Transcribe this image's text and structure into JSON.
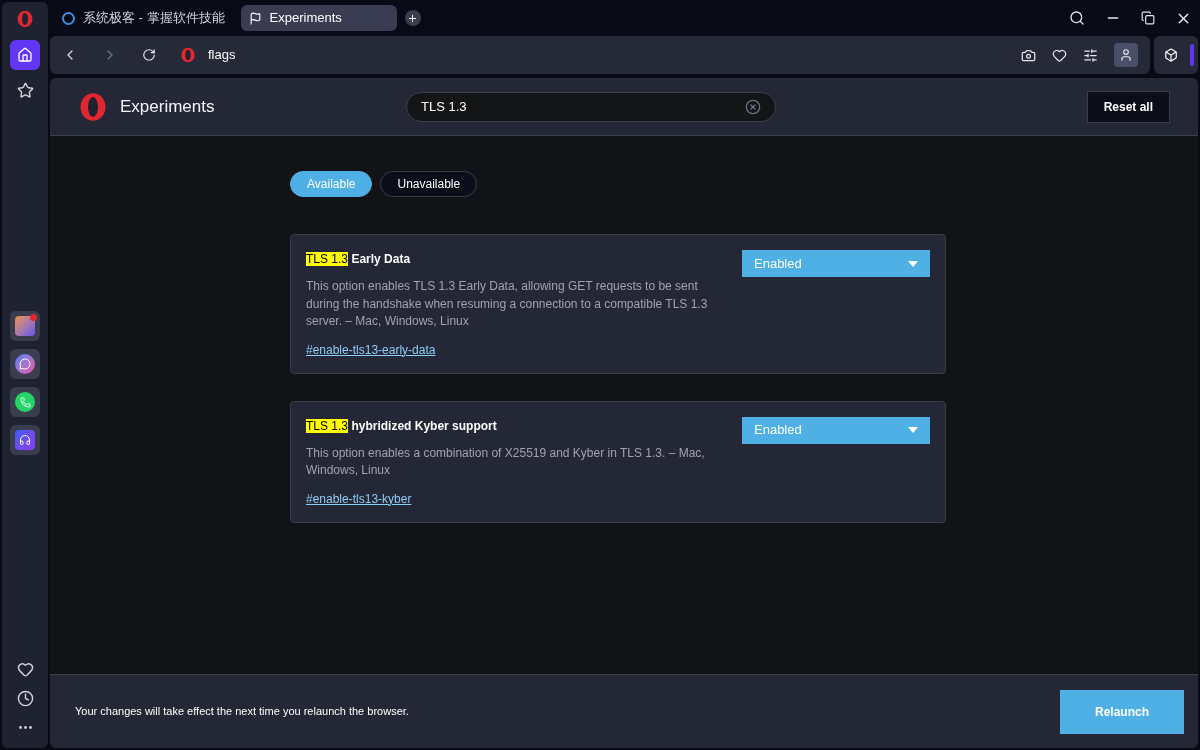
{
  "tabs": [
    {
      "title": "系统极客 - 掌握软件技能",
      "selected": false
    },
    {
      "title": "Experiments",
      "selected": true
    }
  ],
  "address_bar": {
    "url": "flags"
  },
  "header": {
    "title": "Experiments",
    "search": {
      "value": "TLS 1.3"
    },
    "reset_button": "Reset all"
  },
  "filter_tabs": [
    {
      "label": "Available",
      "selected": true
    },
    {
      "label": "Unavailable",
      "selected": false
    }
  ],
  "flags": [
    {
      "title": [
        {
          "text": "TLS 1.3",
          "highlighted": true
        },
        {
          "text": "Early Data",
          "highlighted": false
        }
      ],
      "description": "This option enables TLS 1.3 Early Data, allowing GET requests to be sent during the handshake when resuming a connection to a compatible TLS 1.3 server. – Mac, Windows, Linux",
      "link": "#enable-tls13-early-data",
      "value": "Enabled"
    },
    {
      "title": [
        {
          "text": "TLS 1.3",
          "highlighted": true
        },
        {
          "text": "hybridized Kyber support",
          "highlighted": false
        }
      ],
      "description": "This option enables a combination of X25519 and Kyber in TLS 1.3. – Mac, Windows, Linux",
      "link": "#enable-tls13-kyber",
      "value": "Enabled"
    }
  ],
  "footer": {
    "message": "Your changes will take effect the next time you relaunch the browser.",
    "relaunch_button": "Relaunch"
  }
}
